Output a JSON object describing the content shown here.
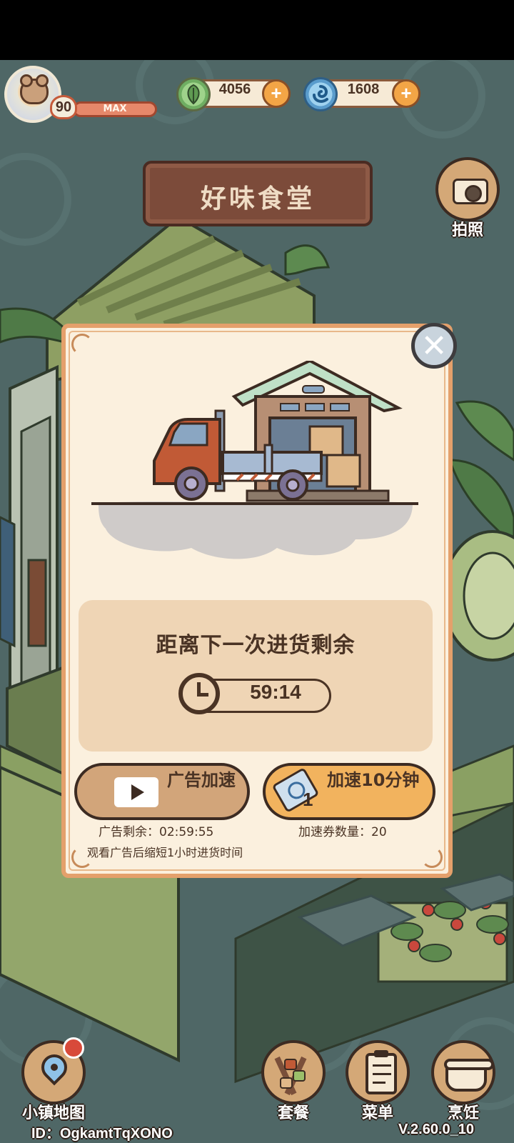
{
  "hud": {
    "level": "90",
    "level_bar_label": "MAX",
    "leaf_currency": "4056",
    "swirl_currency": "1608"
  },
  "restaurant_sign": "好味食堂",
  "camera_label": "拍照",
  "dialog": {
    "title": "距离下一次进货剩余",
    "countdown": "59:14",
    "ad_button_label": "广告加速",
    "speed_button_label": "加速10分钟",
    "speed_ticket_badge": "1",
    "ad_remaining": "广告剩余：02:59:55",
    "ticket_count": "加速券数量：20",
    "ad_hint": "观看广告后缩短1小时进货时间"
  },
  "bottom_nav": {
    "map_label": "小镇地图",
    "set_meal_label": "套餐",
    "menu_label": "菜单",
    "cook_label": "烹饪"
  },
  "footer": {
    "player_id": "ID：OgkamtTqXONO",
    "version": "V.2.60.0_10"
  },
  "colors": {
    "modal_bg": "#fbf0de",
    "modal_border": "#e4a06b",
    "speed_button": "#f2b35e",
    "ad_button": "#d2a57a",
    "notification": "#d84a3a"
  },
  "icons": [
    "leaf-icon",
    "swirl-icon",
    "plus-icon",
    "camera-icon",
    "close-icon",
    "clock-icon",
    "play-icon",
    "ticket-icon",
    "map-pin-icon",
    "skewer-icon",
    "clipboard-icon",
    "pot-icon"
  ]
}
